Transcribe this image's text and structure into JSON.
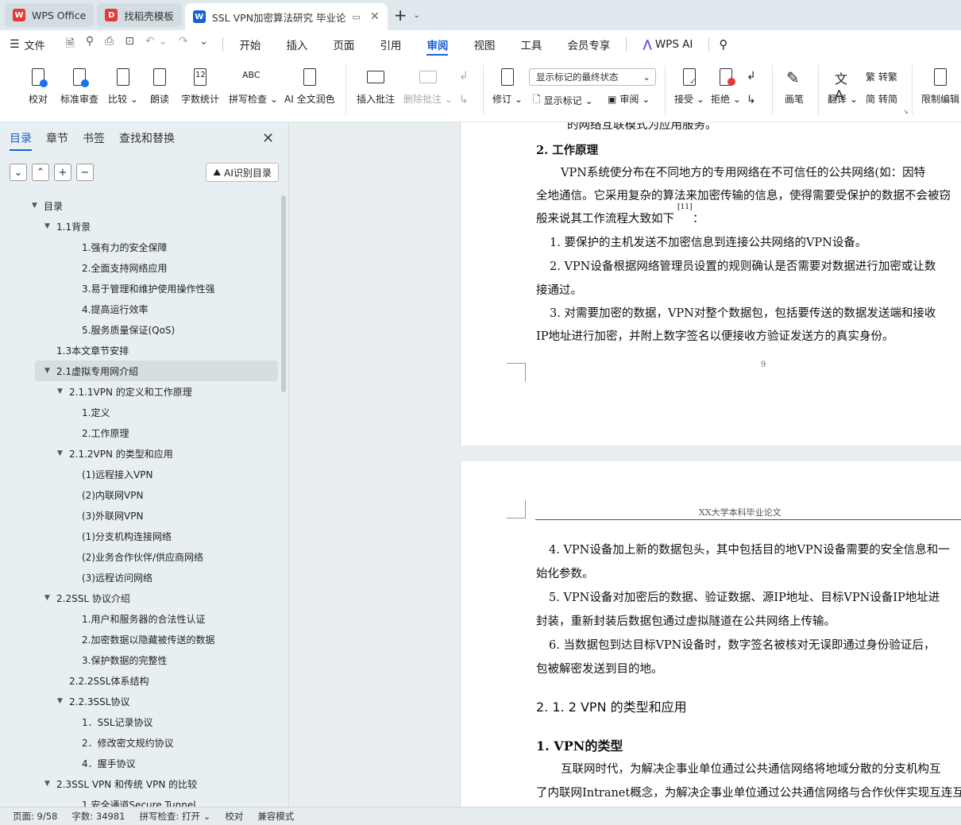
{
  "tabs": [
    {
      "label": "WPS Office",
      "logo": "W",
      "logo_color": "#e53935"
    },
    {
      "label": "找稻壳模板",
      "logo": "D",
      "logo_color": "#e53935"
    },
    {
      "label": "SSL VPN加密算法研究 毕业论",
      "logo": "W",
      "logo_color": "#1a5fd6"
    }
  ],
  "menu": {
    "file_label": "文件",
    "items": [
      "开始",
      "插入",
      "页面",
      "引用",
      "审阅",
      "视图",
      "工具",
      "会员专享"
    ],
    "active": "审阅",
    "ai_label": "WPS AI"
  },
  "ribbon": {
    "proofread": "校对",
    "standard_review": "标准审查",
    "compare": "比较",
    "read_aloud": "朗读",
    "word_count": "字数统计",
    "spell_check": "拼写检查",
    "ai_polish": "AI 全文润色",
    "insert_comment": "插入批注",
    "delete_comment": "删除批注",
    "track_changes": "修订",
    "display_mode_value": "显示标记的最终状态",
    "show_markup": "显示标记",
    "review": "审阅",
    "accept": "接受",
    "reject": "拒绝",
    "pen": "画笔",
    "translate": "翻译",
    "to_traditional": "转繁",
    "to_simplified": "转简",
    "restrict_edit": "限制编辑",
    "word_count_icon_text": "12",
    "spell_icon_text": "ABC"
  },
  "panel": {
    "tabs": [
      "目录",
      "章节",
      "书签",
      "查找和替换"
    ],
    "active_tab": "目录",
    "ai_button": "AI识别目录",
    "toc": [
      {
        "label": "目录",
        "level": 0,
        "expanded": true
      },
      {
        "label": "1.1背景",
        "level": 1,
        "expanded": true
      },
      {
        "label": "1.强有力的安全保障",
        "level": 3
      },
      {
        "label": "2.全面支持网络应用",
        "level": 3
      },
      {
        "label": "3.易于管理和维护使用操作性强",
        "level": 3
      },
      {
        "label": "4.提高运行效率",
        "level": 3
      },
      {
        "label": "5.服务质量保证(QoS)",
        "level": 3
      },
      {
        "label": "1.3本文章节安排",
        "level": 1
      },
      {
        "label": "2.1虚拟专用网介绍",
        "level": 1,
        "expanded": true,
        "selected": true
      },
      {
        "label": "2.1.1VPN 的定义和工作原理",
        "level": 2,
        "expanded": true
      },
      {
        "label": "1.定义",
        "level": 3
      },
      {
        "label": "2.工作原理",
        "level": 3
      },
      {
        "label": "2.1.2VPN 的类型和应用",
        "level": 2,
        "expanded": true
      },
      {
        "label": "(1)远程接入VPN",
        "level": 3
      },
      {
        "label": "(2)内联网VPN",
        "level": 3
      },
      {
        "label": "(3)外联网VPN",
        "level": 3
      },
      {
        "label": "(1)分支机构连接网络",
        "level": 3
      },
      {
        "label": "(2)业务合作伙伴/供应商网络",
        "level": 3
      },
      {
        "label": "(3)远程访问网络",
        "level": 3
      },
      {
        "label": "2.2SSL 协议介绍",
        "level": 1,
        "expanded": true
      },
      {
        "label": "1.用户和服务器的合法性认证",
        "level": 3
      },
      {
        "label": "2.加密数据以隐藏被传送的数据",
        "level": 3
      },
      {
        "label": "3.保护数据的完整性",
        "level": 3
      },
      {
        "label": "2.2.2SSL体系结构",
        "level": 2
      },
      {
        "label": "2.2.3SSL协议",
        "level": 2,
        "expanded": true
      },
      {
        "label": "1．SSL记录协议",
        "level": 3
      },
      {
        "label": "2．修改密文规约协议",
        "level": 3
      },
      {
        "label": "4．握手协议",
        "level": 3
      },
      {
        "label": "2.3SSL VPN 和传统 VPN 的比较",
        "level": 1,
        "expanded": true
      },
      {
        "label": "1.安全通道Secure Tunnel",
        "level": 3
      }
    ]
  },
  "document": {
    "page1": {
      "lines": [
        "的网络互联模式为应用服务。",
        "2.   工作原理",
        "VPN系统使分布在不同地方的专用网络在不可信任的公共网络(如：因特",
        "全地通信。它采用复杂的算法来加密传输的信息，使得需要受保护的数据不会被窃",
        "般来说其工作流程大致如下",
        "[11]",
        "：",
        "1.  要保护的主机发送不加密信息到连接公共网络的VPN设备。",
        "2.  VPN设备根据网络管理员设置的规则确认是否需要对数据进行加密或让数",
        "接通过。",
        "3.  对需要加密的数据，VPN对整个数据包，包括要传送的数据发送端和接收",
        "IP地址进行加密，并附上数字签名以便接收方验证发送方的真实身份。"
      ],
      "page_number": "9"
    },
    "page2": {
      "header": "XX大学本科毕业论文",
      "lines": [
        "4. VPN设备加上新的数据包头，其中包括目的地VPN设备需要的安全信息和一",
        "始化参数。",
        "5. VPN设备对加密后的数据、验证数据、源IP地址、目标VPN设备IP地址进",
        "封装，重新封装后数据包通过虚拟隧道在公共网络上传输。",
        "6.  当数据包到达目标VPN设备时，数字签名被核对无误即通过身份验证后，",
        "包被解密发送到目的地。",
        "2. 1. 2  VPN 的类型和应用",
        "1.    VPN的类型",
        "互联网时代，为解决企事业单位通过公共通信网络将地域分散的分支机构互",
        "了内联网Intranet概念，为解决企事业单位通过公共通信网络与合作伙伴实现互连互"
      ]
    }
  },
  "status": {
    "page": "页面: 9/58",
    "words": "字数: 34981",
    "spell": "拼写检查: 打开",
    "proof": "校对",
    "compat": "兼容模式"
  }
}
